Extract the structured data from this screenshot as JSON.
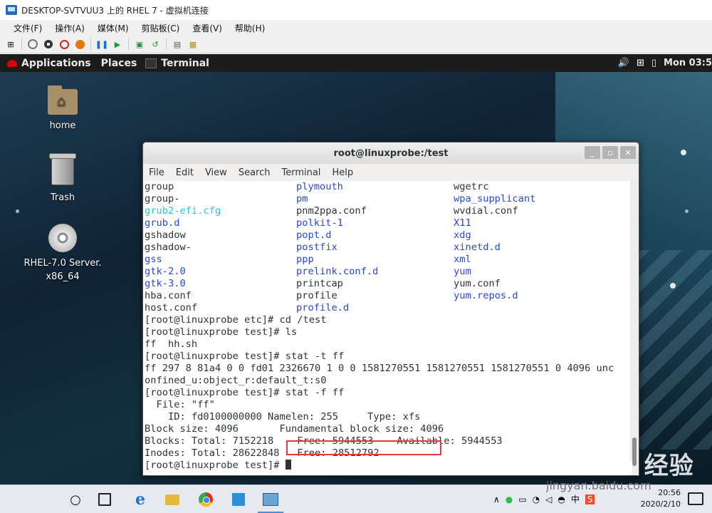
{
  "host": {
    "title": "DESKTOP-SVTVUU3 上的 RHEL 7 - 虚拟机连接",
    "menu": [
      "文件(F)",
      "操作(A)",
      "媒体(M)",
      "剪贴板(C)",
      "查看(V)",
      "帮助(H)"
    ]
  },
  "gnome": {
    "applications": "Applications",
    "places": "Places",
    "active_app": "Terminal",
    "clock": "Mon 03:5"
  },
  "desktop": {
    "icons": [
      {
        "label": "home"
      },
      {
        "label": "Trash"
      },
      {
        "label": "RHEL-7.0 Server.",
        "label2": "x86_64"
      }
    ]
  },
  "terminal": {
    "title": "root@linuxprobe:/test",
    "menu": [
      "File",
      "Edit",
      "View",
      "Search",
      "Terminal",
      "Help"
    ],
    "listing_rows": [
      [
        {
          "t": "group",
          "c": "n"
        },
        {
          "t": "plymouth",
          "c": "b"
        },
        {
          "t": "wgetrc",
          "c": "n"
        }
      ],
      [
        {
          "t": "group-",
          "c": "n"
        },
        {
          "t": "pm",
          "c": "b"
        },
        {
          "t": "wpa_supplicant",
          "c": "b"
        }
      ],
      [
        {
          "t": "grub2-efi.cfg",
          "c": "c"
        },
        {
          "t": "pnm2ppa.conf",
          "c": "n"
        },
        {
          "t": "wvdial.conf",
          "c": "n"
        }
      ],
      [
        {
          "t": "grub.d",
          "c": "b"
        },
        {
          "t": "polkit-1",
          "c": "b"
        },
        {
          "t": "X11",
          "c": "b"
        }
      ],
      [
        {
          "t": "gshadow",
          "c": "n"
        },
        {
          "t": "popt.d",
          "c": "b"
        },
        {
          "t": "xdg",
          "c": "b"
        }
      ],
      [
        {
          "t": "gshadow-",
          "c": "n"
        },
        {
          "t": "postfix",
          "c": "b"
        },
        {
          "t": "xinetd.d",
          "c": "b"
        }
      ],
      [
        {
          "t": "gss",
          "c": "b"
        },
        {
          "t": "ppp",
          "c": "b"
        },
        {
          "t": "xml",
          "c": "b"
        }
      ],
      [
        {
          "t": "gtk-2.0",
          "c": "b"
        },
        {
          "t": "prelink.conf.d",
          "c": "b"
        },
        {
          "t": "yum",
          "c": "b"
        }
      ],
      [
        {
          "t": "gtk-3.0",
          "c": "b"
        },
        {
          "t": "printcap",
          "c": "n"
        },
        {
          "t": "yum.conf",
          "c": "n"
        }
      ],
      [
        {
          "t": "hba.conf",
          "c": "n"
        },
        {
          "t": "profile",
          "c": "n"
        },
        {
          "t": "yum.repos.d",
          "c": "b"
        }
      ],
      [
        {
          "t": "host.conf",
          "c": "n"
        },
        {
          "t": "profile.d",
          "c": "b"
        },
        {
          "t": "",
          "c": "n"
        }
      ]
    ],
    "plain_lines": [
      "[root@linuxprobe etc]# cd /test",
      "[root@linuxprobe test]# ls",
      "ff  hh.sh",
      "[root@linuxprobe test]# stat -t ff",
      "ff 297 8 81a4 0 0 fd01 2326670 1 0 0 1581270551 1581270551 1581270551 0 4096 unc",
      "onfined_u:object_r:default_t:s0",
      "[root@linuxprobe test]# stat -f ff",
      "  File: \"ff\"",
      "    ID: fd0100000000 Namelen: 255     Type: xfs",
      "Block size: 4096       Fundamental block size: 4096",
      "Blocks: Total: 7152218    Free: 5944553    Available: 5944553",
      "Inodes: Total: 28622848   Free: 28512792"
    ],
    "prompt": "[root@linuxprobe test]# "
  },
  "taskbar": {
    "time": "20:56",
    "date": "2020/2/10",
    "ime": "中",
    "watermark": "Bai du 经验",
    "watermark_url": "jingyan.baidu.com"
  }
}
